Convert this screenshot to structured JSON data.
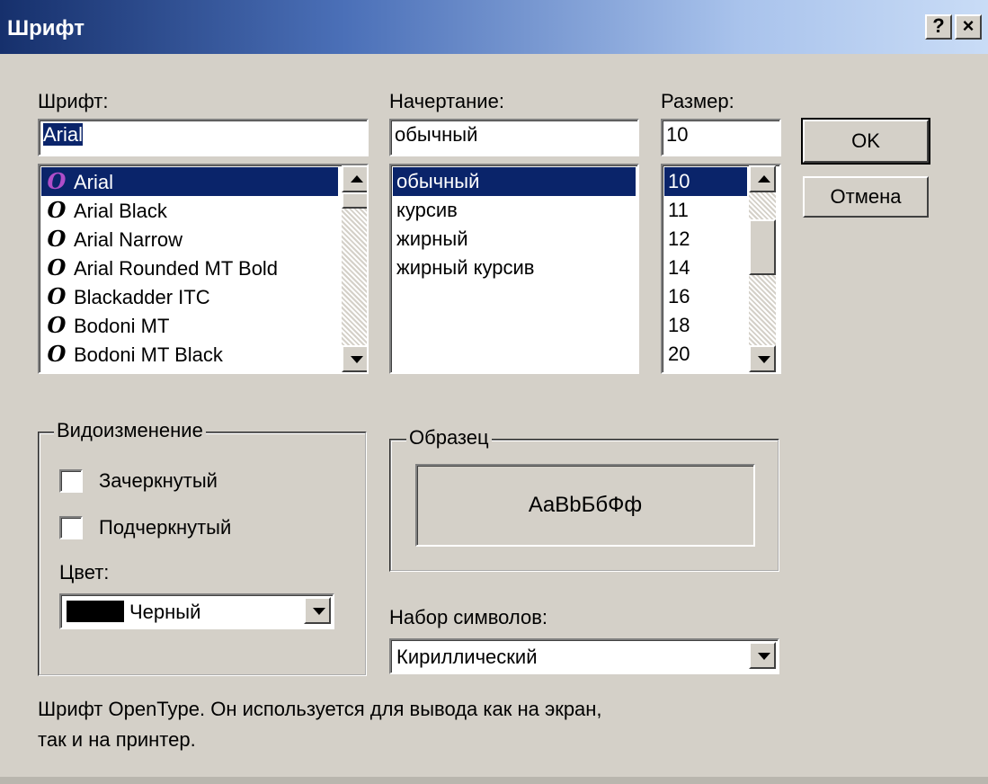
{
  "dialog": {
    "title": "Шрифт",
    "help_button": "?",
    "close_button": "×"
  },
  "font": {
    "label": "Шрифт:",
    "value": "Arial",
    "items": [
      "Arial",
      "Arial Black",
      "Arial Narrow",
      "Arial Rounded MT Bold",
      "Blackadder ITC",
      "Bodoni MT",
      "Bodoni MT Black"
    ],
    "selected_index": 0,
    "icon_name": "opentype-font-icon",
    "icon_glyph": "O"
  },
  "style": {
    "label": "Начертание:",
    "value": "обычный",
    "items": [
      "обычный",
      "курсив",
      "жирный",
      "жирный курсив"
    ],
    "selected_index": 0
  },
  "size": {
    "label": "Размер:",
    "value": "10",
    "items": [
      "10",
      "11",
      "12",
      "14",
      "16",
      "18",
      "20"
    ],
    "selected_index": 0
  },
  "buttons": {
    "ok": "OK",
    "cancel": "Отмена"
  },
  "effects": {
    "title": "Видоизменение",
    "strikeout": "Зачеркнутый",
    "underline": "Подчеркнутый",
    "strikeout_checked": false,
    "underline_checked": false,
    "color_label": "Цвет:",
    "color_value": "Черный",
    "color_hex": "#000000"
  },
  "sample": {
    "title": "Образец",
    "text": "AaBbБбФф"
  },
  "charset": {
    "label": "Набор символов:",
    "value": "Кириллический"
  },
  "description": {
    "line1": "Шрифт OpenType. Он используется для вывода как на экран,",
    "line2": "так и на принтер."
  },
  "colors": {
    "selection": "#0a246a",
    "face": "#d4d0c8",
    "title_start": "#16306c",
    "title_end": "#c9dcf6"
  }
}
